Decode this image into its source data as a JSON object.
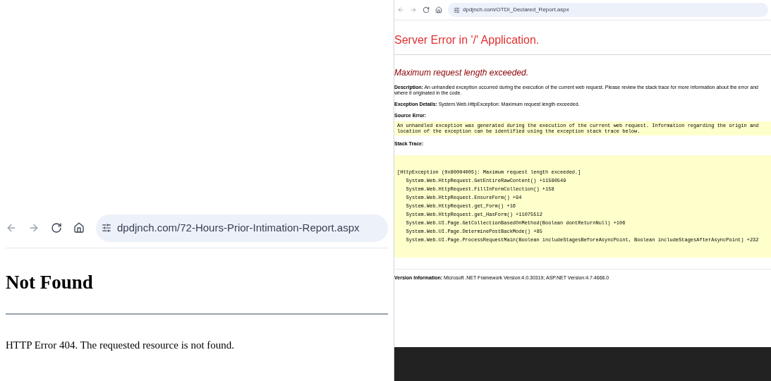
{
  "left_window": {
    "url": "dpdjnch.com/72-Hours-Prior-Intimation-Report.aspx",
    "heading": "Not Found",
    "message": "HTTP Error 404. The requested resource is not found."
  },
  "right_window": {
    "url": "dpdjnch.com/OTDI_Declared_Report.aspx",
    "title": "Server Error in '/' Application.",
    "error": "Maximum request length exceeded.",
    "description": {
      "label": "Description:",
      "text": "An unhandled exception occurred during the execution of the current web request. Please review the stack trace for more information about the error and where it originated in the code."
    },
    "exception_details": {
      "label": "Exception Details:",
      "text": "System.Web.HttpException: Maximum request length exceeded."
    },
    "source_error_label": "Source Error:",
    "source_error": "An unhandled exception was generated during the execution of the current web request. Information regarding the origin and location of the exception can be identified using the exception stack trace below.",
    "stack_trace_label": "Stack Trace:",
    "stack_trace": [
      "[HttpException (0x80004005): Maximum request length exceeded.]",
      "   System.Web.HttpRequest.GetEntireRawContent() +11580549",
      "   System.Web.HttpRequest.FillInFormCollection() +158",
      "   System.Web.HttpRequest.EnsureForm() +94",
      "   System.Web.HttpRequest.get_Form() +16",
      "   System.Web.HttpRequest.get_HasForm() +11075512",
      "   System.Web.UI.Page.GetCollectionBasedOnMethod(Boolean dontReturnNull) +106",
      "   System.Web.UI.Page.DeterminePostBackMode() +85",
      "   System.Web.UI.Page.ProcessRequestMain(Boolean includeStagesBeforeAsyncPoint, Boolean includeStagesAfterAsyncPoint) +232"
    ],
    "version": {
      "label": "Version Information:",
      "text": "Microsoft .NET Framework Version:4.0.30319; ASP.NET Version:4.7.4666.0"
    }
  }
}
